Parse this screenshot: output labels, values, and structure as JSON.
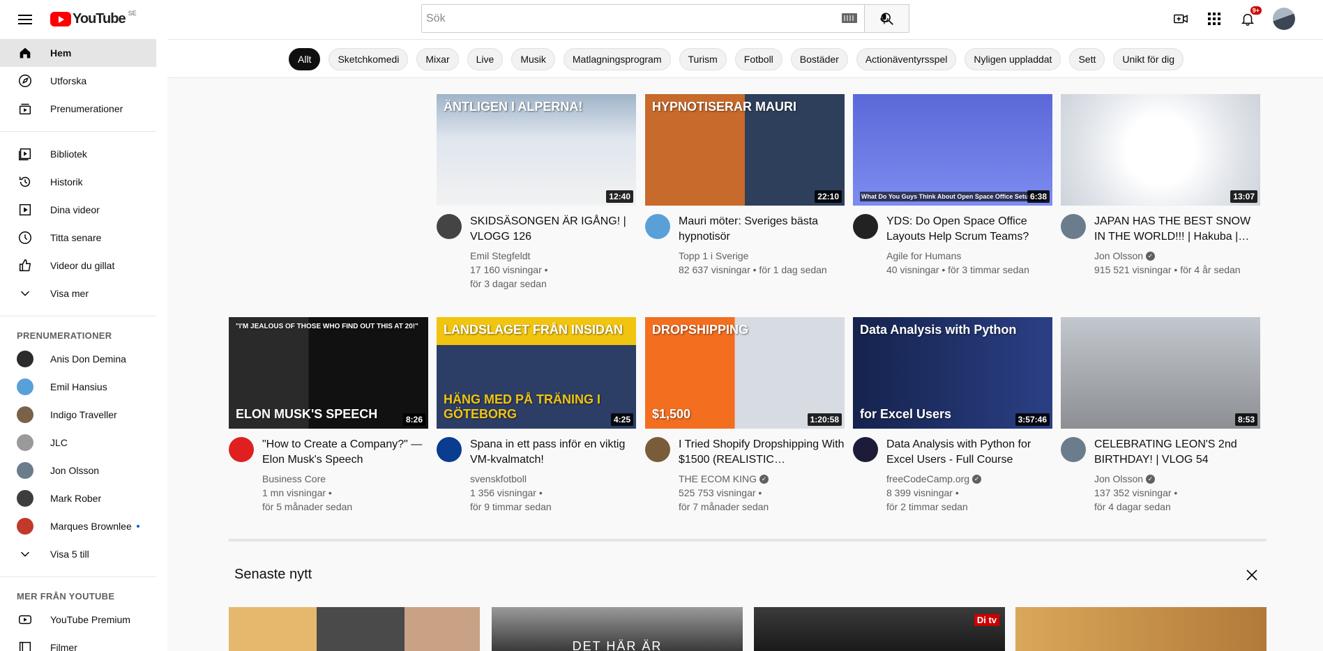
{
  "masthead": {
    "logo_text": "YouTube",
    "country": "SE",
    "search_placeholder": "Sök",
    "notifications_badge": "9+"
  },
  "sidebar": {
    "main": [
      {
        "label": "Hem",
        "icon": "home-icon",
        "active": true
      },
      {
        "label": "Utforska",
        "icon": "compass-icon"
      },
      {
        "label": "Prenumerationer",
        "icon": "subscriptions-icon"
      }
    ],
    "library": [
      {
        "label": "Bibliotek",
        "icon": "library-icon"
      },
      {
        "label": "Historik",
        "icon": "history-icon"
      },
      {
        "label": "Dina videor",
        "icon": "your-videos-icon"
      },
      {
        "label": "Titta senare",
        "icon": "watch-later-icon"
      },
      {
        "label": "Videor du gillat",
        "icon": "like-icon"
      },
      {
        "label": "Visa mer",
        "icon": "chevron-down-icon"
      }
    ],
    "subscriptions_heading": "PRENUMERATIONER",
    "subscriptions": [
      {
        "label": "Anis Don Demina",
        "color": "#2b2b2b"
      },
      {
        "label": "Emil Hansius",
        "color": "#5aa0d8"
      },
      {
        "label": "Indigo Traveller",
        "color": "#7a6248"
      },
      {
        "label": "JLC",
        "color": "#9a9a9a"
      },
      {
        "label": "Jon Olsson",
        "color": "#6b7c8c"
      },
      {
        "label": "Mark Rober",
        "color": "#3d3d3d"
      },
      {
        "label": "Marques Brownlee",
        "color": "#c0392b",
        "live": true
      }
    ],
    "show_more": "Visa 5 till",
    "more_heading": "MER FRÅN YOUTUBE",
    "more": [
      {
        "label": "YouTube Premium",
        "icon": "youtube-premium-icon"
      },
      {
        "label": "Filmer",
        "icon": "film-icon"
      }
    ]
  },
  "chips": [
    "Allt",
    "Sketchkomedi",
    "Mixar",
    "Live",
    "Musik",
    "Matlagningsprogram",
    "Turism",
    "Fotboll",
    "Bostäder",
    "Actionäventyrsspel",
    "Nyligen uppladdat",
    "Sett",
    "Unikt för dig"
  ],
  "videos_row1": [
    {
      "title": "SKIDSÄSONGEN ÄR IGÅNG! | VLOGG 126",
      "channel": "Emil Stegfeldt",
      "views": "17 160 visningar •",
      "age": "för 3 dagar sedan",
      "duration": "12:40",
      "thumb_text": "ÄNTLIGEN I ALPERNA!",
      "verified": false
    },
    {
      "title": "Mauri möter: Sveriges bästa hypnotisör",
      "channel": "Topp 1 i Sverige",
      "views": "82 637 visningar • för 1 dag sedan",
      "age": "",
      "duration": "22:10",
      "thumb_text": "HYPNOTISERAR MAURI",
      "verified": false
    },
    {
      "title": "YDS: Do Open Space Office Layouts Help Scrum Teams?",
      "channel": "Agile for Humans",
      "views": "40 visningar • för 3 timmar sedan",
      "age": "",
      "duration": "6:38",
      "thumb_text": "What Do You Guys Think About Open Space Office Setups?",
      "verified": false
    },
    {
      "title": "JAPAN HAS THE BEST SNOW IN THE WORLD!!! | Hakuba |…",
      "channel": "Jon Olsson",
      "views": "915 521 visningar • för 4 år sedan",
      "age": "",
      "duration": "13:07",
      "thumb_text": "",
      "verified": true
    }
  ],
  "videos_row2": [
    {
      "title": "\"How to Create a Company?\" — Elon Musk's Speech",
      "channel": "Business Core",
      "views": "1 mn visningar •",
      "age": "för 5 månader sedan",
      "duration": "8:26",
      "thumb_text": "\"I'M JEALOUS OF THOSE WHO FIND OUT THIS AT 20!\"",
      "thumb_sub": "ELON MUSK'S SPEECH",
      "verified": false
    },
    {
      "title": "Spana in ett pass inför en viktig VM-kvalmatch!",
      "channel": "svenskfotboll",
      "views": "1 356 visningar •",
      "age": "för 9 timmar sedan",
      "duration": "4:25",
      "thumb_text": "LANDSLAGET FRÅN INSIDAN",
      "thumb_sub": "HÄNG MED PÅ TRÄNING I GÖTEBORG",
      "verified": false
    },
    {
      "title": "I Tried Shopify Dropshipping With $1500 (REALISTIC…",
      "channel": "THE ECOM KING",
      "views": "525 753 visningar •",
      "age": "för 7 månader sedan",
      "duration": "1:20:58",
      "thumb_text": "DROPSHIPPING",
      "thumb_sub": "$1,500",
      "verified": true
    },
    {
      "title": "Data Analysis with Python for Excel Users - Full Course",
      "channel": "freeCodeCamp.org",
      "views": "8 399 visningar •",
      "age": "för 2 timmar sedan",
      "duration": "3:57:46",
      "thumb_text": "Data Analysis with Python",
      "thumb_sub": "for Excel Users",
      "verified": true
    },
    {
      "title": "CELEBRATING LEON'S 2nd BIRTHDAY! | VLOG 54",
      "channel": "Jon Olsson",
      "views": "137 352 visningar •",
      "age": "för 4 dagar sedan",
      "duration": "8:53",
      "thumb_text": "",
      "thumb_sub": "",
      "verified": true
    }
  ],
  "news_section": {
    "title": "Senaste nytt",
    "thumb_text_2": "DET HÄR ÄR",
    "thumb_text_3": "Di tv"
  },
  "colors": {
    "brand_red": "#ff0000",
    "text_secondary": "#606060",
    "chip_active_bg": "#0f0f0f"
  }
}
